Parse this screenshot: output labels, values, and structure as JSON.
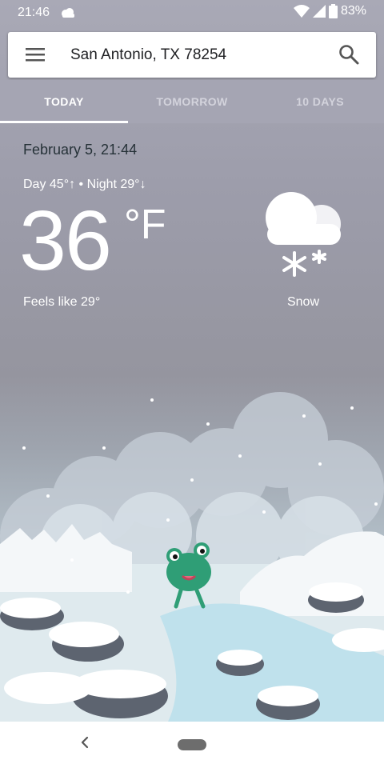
{
  "status_bar": {
    "time": "21:46",
    "battery": "83%"
  },
  "search": {
    "location": "San Antonio, TX 78254"
  },
  "tabs": [
    {
      "label": "TODAY",
      "active": true
    },
    {
      "label": "TOMORROW",
      "active": false
    },
    {
      "label": "10 DAYS",
      "active": false
    }
  ],
  "weather": {
    "date": "February 5, 21:44",
    "day_night": "Day 45°↑ • Night 29°↓",
    "temperature": "36",
    "unit": "°F",
    "feels_like": "Feels like 29°",
    "condition": "Snow",
    "icon": "snow-icon"
  },
  "icons": {
    "status": [
      "cloud-icon",
      "wifi-icon",
      "cellular-signal-icon",
      "battery-icon"
    ],
    "search_bar": [
      "menu-icon",
      "search-icon"
    ],
    "nav": [
      "back-icon",
      "home-pill"
    ]
  },
  "colors": {
    "accent": "#ffffff",
    "tab_background": "#a5a5b3",
    "text_dark": "#263238"
  }
}
